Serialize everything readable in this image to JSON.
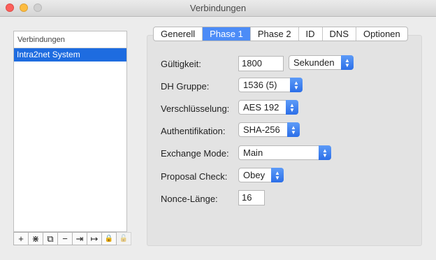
{
  "window": {
    "title": "Verbindungen"
  },
  "sidebar": {
    "header": "Verbindungen",
    "items": [
      {
        "label": "Intra2net System",
        "selected": true
      }
    ]
  },
  "toolbar": {
    "add": "+",
    "wizard": "⋇",
    "duplicate": "⧉",
    "remove": "−",
    "import": "⇥",
    "export": "↦",
    "lock": "🔒",
    "unlock": "🔓"
  },
  "tabs": [
    "Generell",
    "Phase 1",
    "Phase 2",
    "ID",
    "DNS",
    "Optionen"
  ],
  "active_tab": "Phase 1",
  "form": {
    "lifetime": {
      "label": "Gültigkeit:",
      "value": "1800",
      "unit": "Sekunden"
    },
    "dh_group": {
      "label": "DH Gruppe:",
      "value": "1536 (5)"
    },
    "encryption": {
      "label": "Verschlüsselung:",
      "value": "AES 192"
    },
    "authentication": {
      "label": "Authentifikation:",
      "value": "SHA-256"
    },
    "exchange_mode": {
      "label": "Exchange Mode:",
      "value": "Main"
    },
    "proposal_check": {
      "label": "Proposal Check:",
      "value": "Obey"
    },
    "nonce_length": {
      "label": "Nonce-Länge:",
      "value": "16"
    }
  },
  "colors": {
    "accent": "#4c8cf7",
    "selection": "#1e6ce0"
  }
}
